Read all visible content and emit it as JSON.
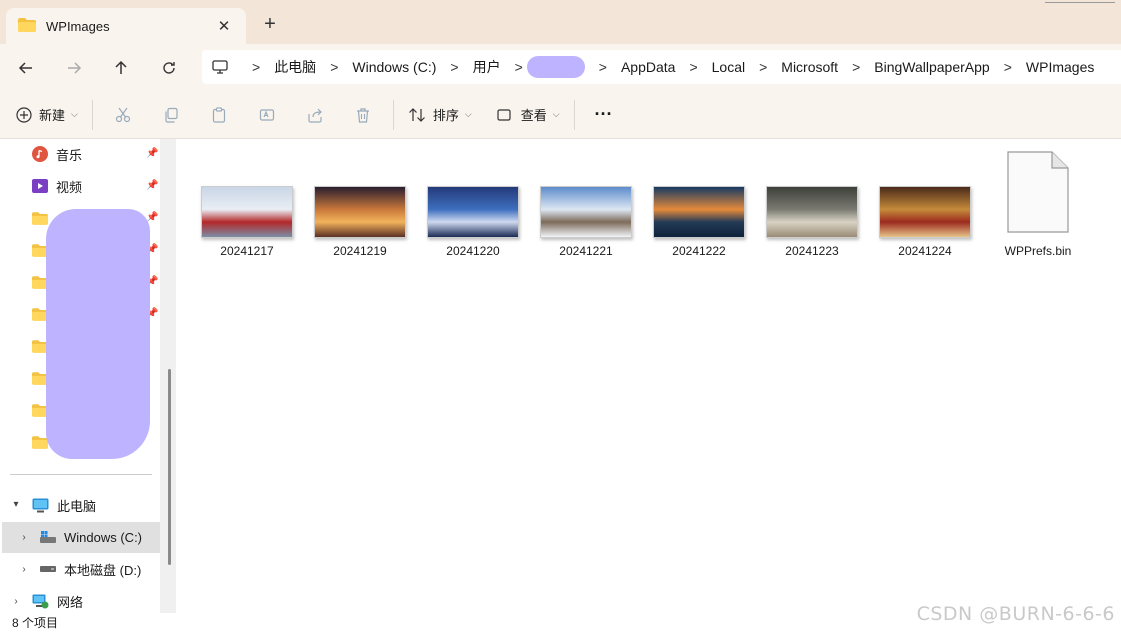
{
  "tab": {
    "title": "WPImages",
    "close_label": "✕",
    "new_tab_label": "+"
  },
  "breadcrumb": {
    "items": [
      "此电脑",
      "Windows (C:)",
      "用户",
      "AppData",
      "Local",
      "Microsoft",
      "BingWallpaperApp",
      "WPImages"
    ],
    "separator": ">"
  },
  "toolbar": {
    "new_label": "新建",
    "sort_label": "排序",
    "view_label": "查看",
    "more_label": "···"
  },
  "sidebar": {
    "quick": [
      {
        "label": "音乐",
        "icon": "music-icon"
      },
      {
        "label": "视频",
        "icon": "video-icon"
      }
    ],
    "this_pc_label": "此电脑",
    "drives": [
      {
        "label": "Windows (C:)",
        "icon": "windows-drive-icon"
      },
      {
        "label": "本地磁盘 (D:)",
        "icon": "hard-drive-icon"
      }
    ],
    "network_label": "网络"
  },
  "files": [
    {
      "name": "20241217",
      "colors": [
        "#c9d6e6",
        "#e9eef4",
        "#b3282a",
        "#7a8ea6"
      ]
    },
    {
      "name": "20241219",
      "colors": [
        "#2a1e2e",
        "#c9783a",
        "#f2b35c",
        "#5a2f24"
      ]
    },
    {
      "name": "20241220",
      "colors": [
        "#243a7a",
        "#3e6fbf",
        "#cfd9ef",
        "#1b2a55"
      ]
    },
    {
      "name": "20241221",
      "colors": [
        "#5d8ccc",
        "#dde7f3",
        "#7d6a5a",
        "#f1f4f8"
      ]
    },
    {
      "name": "20241222",
      "colors": [
        "#173a63",
        "#e58a3a",
        "#243b56",
        "#0f223c"
      ]
    },
    {
      "name": "20241223",
      "colors": [
        "#3d3f3a",
        "#7b7b72",
        "#d8d2c4",
        "#9a8c76"
      ]
    },
    {
      "name": "20241224",
      "colors": [
        "#4a2a1a",
        "#c58a3a",
        "#9b2a1e",
        "#e6c48a"
      ]
    },
    {
      "name": "WPPrefs.bin",
      "colors": []
    }
  ],
  "status": {
    "count_label": "8 个项目"
  },
  "watermark": "CSDN @BURN-6-6-6"
}
